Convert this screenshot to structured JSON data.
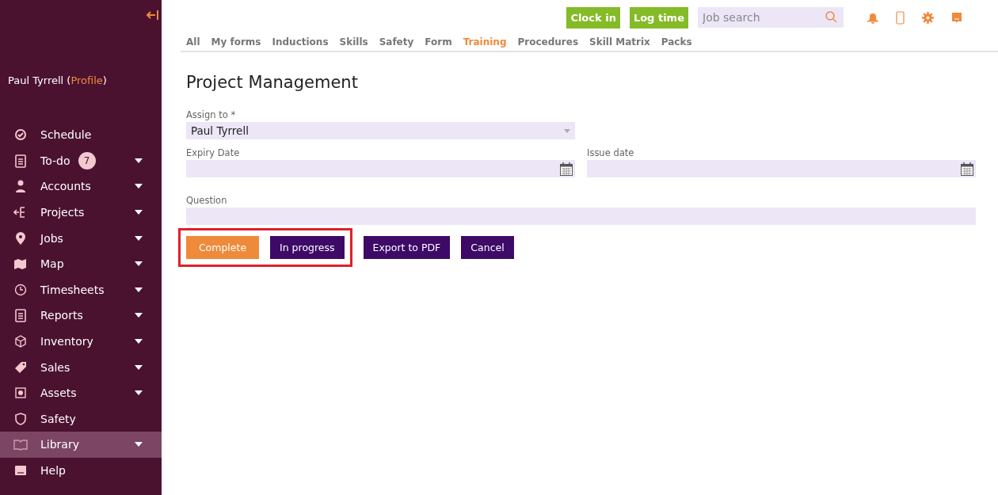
{
  "sidebar": {
    "user": {
      "name": "Paul Tyrrell",
      "open": "(",
      "link": "Profile",
      "close": ")"
    },
    "items": [
      {
        "label": "Schedule",
        "expandable": false,
        "selected": false
      },
      {
        "label": "To-do",
        "expandable": true,
        "selected": false,
        "badge": "7"
      },
      {
        "label": "Accounts",
        "expandable": true,
        "selected": false
      },
      {
        "label": "Projects",
        "expandable": true,
        "selected": false
      },
      {
        "label": "Jobs",
        "expandable": true,
        "selected": false
      },
      {
        "label": "Map",
        "expandable": true,
        "selected": false
      },
      {
        "label": "Timesheets",
        "expandable": true,
        "selected": false
      },
      {
        "label": "Reports",
        "expandable": true,
        "selected": false
      },
      {
        "label": "Inventory",
        "expandable": true,
        "selected": false
      },
      {
        "label": "Sales",
        "expandable": true,
        "selected": false
      },
      {
        "label": "Assets",
        "expandable": true,
        "selected": false
      },
      {
        "label": "Safety",
        "expandable": false,
        "selected": false
      },
      {
        "label": "Library",
        "expandable": true,
        "selected": true
      },
      {
        "label": "Help",
        "expandable": false,
        "selected": false
      }
    ]
  },
  "topbar": {
    "buttons": [
      "Clock in",
      "Log time"
    ],
    "search": {
      "placeholder": "Job search"
    }
  },
  "tabs": [
    {
      "label": "All",
      "selected": false
    },
    {
      "label": "My forms",
      "selected": false
    },
    {
      "label": "Inductions",
      "selected": false
    },
    {
      "label": "Skills",
      "selected": false
    },
    {
      "label": "Safety",
      "selected": false
    },
    {
      "label": "Form",
      "selected": false
    },
    {
      "label": "Training",
      "selected": true
    },
    {
      "label": "Procedures",
      "selected": false
    },
    {
      "label": "Skill Matrix",
      "selected": false
    },
    {
      "label": "Packs",
      "selected": false
    }
  ],
  "form": {
    "title": "Project Management",
    "assign": {
      "label": "Assign to *",
      "value": "Paul Tyrrell"
    },
    "dates": [
      {
        "label": "Expiry Date"
      },
      {
        "label": "Issue date"
      }
    ],
    "question": {
      "label": "Question"
    }
  },
  "buttons": [
    {
      "label": "Complete",
      "kind": "primary",
      "highlighted": true
    },
    {
      "label": "In progress",
      "kind": "secondary",
      "highlighted": true
    },
    {
      "label": "Export to PDF",
      "kind": "secondary",
      "highlighted": false
    },
    {
      "label": "Cancel",
      "kind": "secondary",
      "highlighted": false
    }
  ]
}
